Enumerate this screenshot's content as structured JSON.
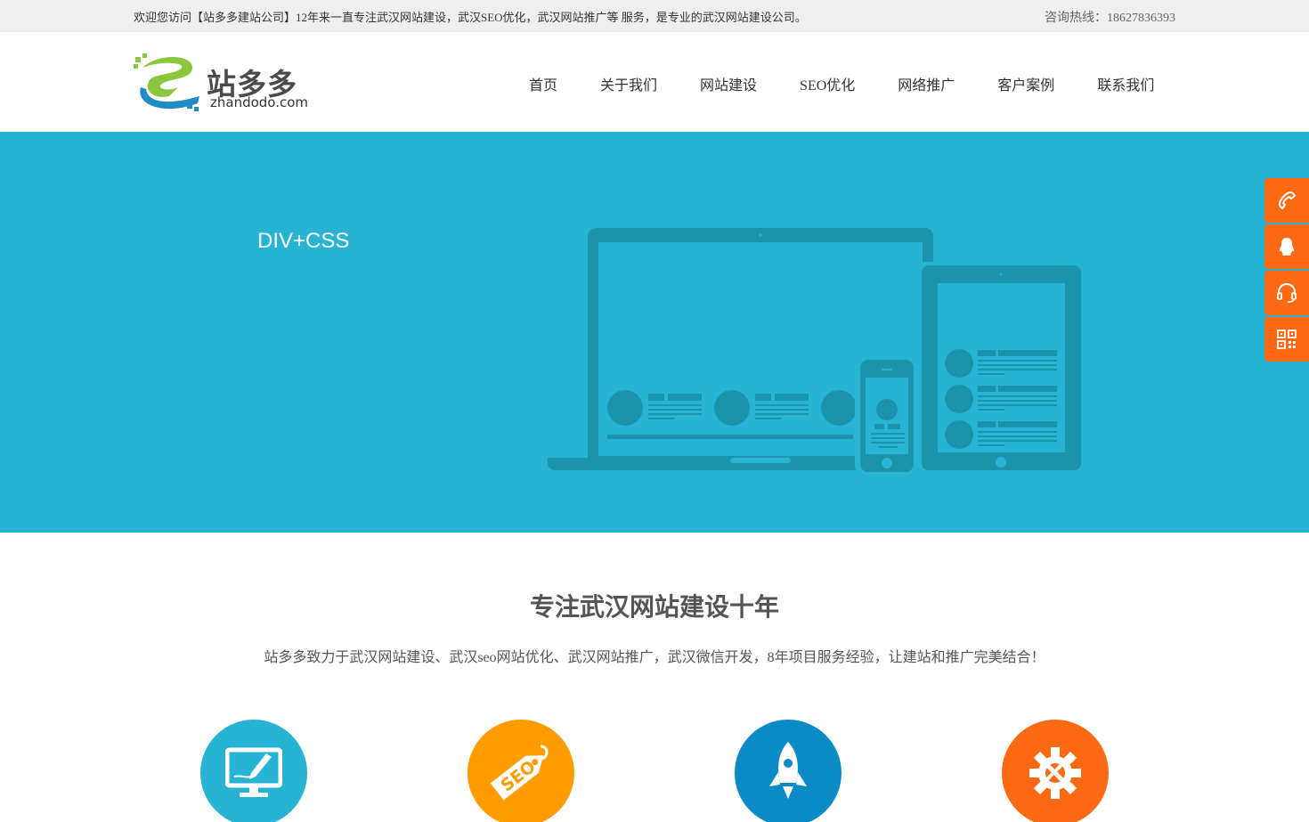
{
  "topbar": {
    "welcome_text": "欢迎您访问【站多多建站公司】12年来一直专注武汉网站建设，武汉SEO优化，武汉网站推广等 服务，是专业的武汉网站建设公司。",
    "hotline_text": "咨询热线：18627836393"
  },
  "logo": {
    "brand_text": "站多多",
    "domain_text": "zhandodo.com"
  },
  "nav": {
    "items": [
      {
        "label": "首页"
      },
      {
        "label": "关于我们"
      },
      {
        "label": "网站建设"
      },
      {
        "label": "SEO优化"
      },
      {
        "label": "网络推广"
      },
      {
        "label": "客户案例"
      },
      {
        "label": "联系我们"
      }
    ]
  },
  "banner": {
    "caption": "DIV+CSS",
    "background_color": "#27b3d4"
  },
  "side_tools": [
    {
      "icon": "phone-icon"
    },
    {
      "icon": "qq-icon"
    },
    {
      "icon": "headset-icon"
    },
    {
      "icon": "qrcode-icon"
    }
  ],
  "intro": {
    "title": "专注武汉网站建设十年",
    "description": "站多多致力于武汉网站建设、武汉seo网站优化、武汉网站推广，武汉微信开发，8年项目服务经验，让建站和推广完美结合！"
  },
  "services": [
    {
      "icon": "web-design-icon",
      "color": "#27b3d4"
    },
    {
      "icon": "seo-tag-icon",
      "color": "#ff9c00",
      "tag_text": "SEO"
    },
    {
      "icon": "rocket-icon",
      "color": "#0b8bc6"
    },
    {
      "icon": "gear-tools-icon",
      "color": "#fd6a13"
    }
  ],
  "colors": {
    "accent_orange": "#fd6a13",
    "topbar_bg": "#efefef",
    "brand_green": "#8cc63f",
    "brand_blue": "#1f8cc4"
  }
}
